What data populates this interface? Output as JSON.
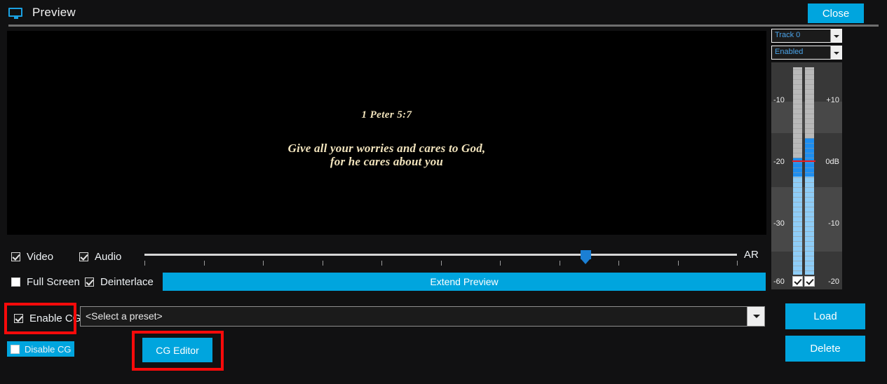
{
  "window": {
    "title": "Preview",
    "title_icon": "monitor-icon",
    "close_label": "Close"
  },
  "preview": {
    "cg_reference": "1 Peter 5:7",
    "cg_line1": "Give all your worries and cares to God,",
    "cg_line2": "for he cares about you"
  },
  "options": {
    "video": {
      "label": "Video",
      "checked": true
    },
    "audio": {
      "label": "Audio",
      "checked": true
    },
    "full_screen": {
      "label": "Full Screen",
      "checked": false
    },
    "deinterlace": {
      "label": "Deinterlace",
      "checked": true
    }
  },
  "transport": {
    "ar_label": "AR",
    "slider_value": 74,
    "slider_min": 0,
    "slider_max": 100,
    "tick_count": 11,
    "extend_preview_label": "Extend Preview"
  },
  "audio_meter": {
    "track_combo": {
      "value": "Track 0"
    },
    "enabled_combo": {
      "value": "Enabled"
    },
    "scale_left": [
      "-10",
      "-20",
      "-30",
      "-60"
    ],
    "scale_right": [
      "+10",
      "0dB",
      "-10",
      "-20"
    ],
    "channels": [
      {
        "name": "left",
        "peak_db": -20.5,
        "rms_db": -60
      },
      {
        "name": "right",
        "peak_db": -14.0,
        "rms_db": -60
      }
    ],
    "peak_marker_db": -21.5,
    "channel_enable_left": true,
    "channel_enable_right": true
  },
  "cg": {
    "enable_label": "Enable CG",
    "enable_checked": true,
    "disable_label": "Disable CG",
    "disable_checked": false,
    "preset_value": "<Select a preset>",
    "editor_label": "CG Editor",
    "load_label": "Load",
    "delete_label": "Delete"
  },
  "colors": {
    "accent": "#00a5de",
    "highlight": "#fa0a0a",
    "meter_high": "#1e8ef0",
    "meter_low": "#8ecdf7",
    "cg_text": "#f2e4bd"
  }
}
